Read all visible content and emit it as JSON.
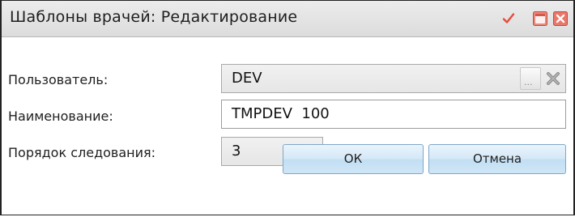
{
  "window": {
    "title": "Шаблоны врачей: Редактирование",
    "accent_color": "#e84b3c",
    "titlebar_icons": [
      "check-icon",
      "minimize-icon",
      "close-icon"
    ]
  },
  "form": {
    "user": {
      "label": "Пользователь:",
      "value": "DEV",
      "select_button_label": "...",
      "clear_icon": "clear-x-icon"
    },
    "name": {
      "label": "Наименование:",
      "value": "TMPDEV  100"
    },
    "order": {
      "label": "Порядок следования:",
      "value": "3"
    }
  },
  "buttons": {
    "ok_label": "ОК",
    "cancel_label": "Отмена"
  }
}
